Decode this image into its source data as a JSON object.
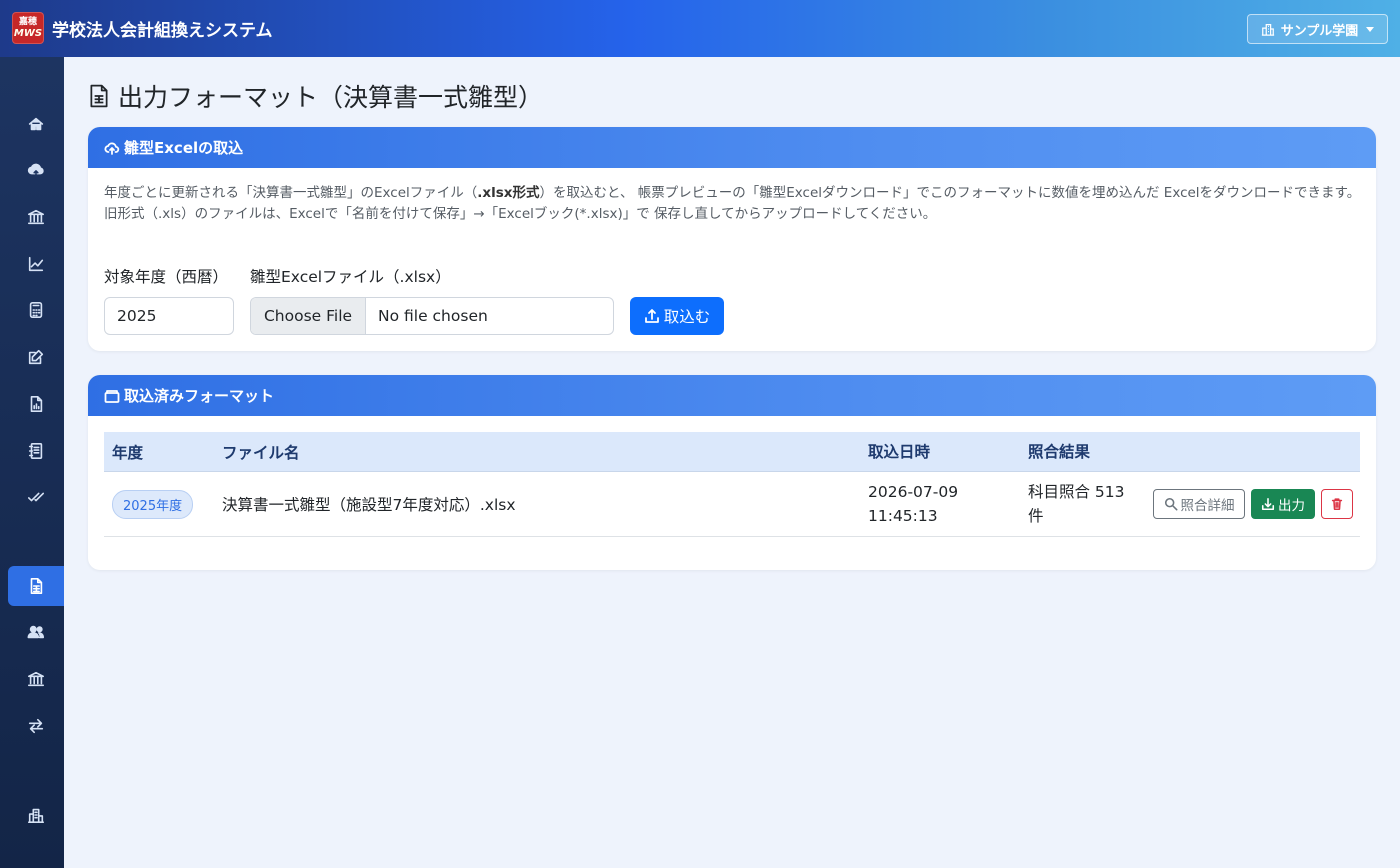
{
  "header": {
    "logo_top": "嘉穂",
    "logo_bottom": "MWS",
    "app_title": "学校法人会計組換えシステム",
    "school_selector": "サンプル学園"
  },
  "sidebar": {
    "items": [
      {
        "icon": "home-icon"
      },
      {
        "icon": "cloud-upload-icon"
      },
      {
        "icon": "bank-icon"
      },
      {
        "icon": "chart-line-icon"
      },
      {
        "icon": "calculator-icon"
      },
      {
        "icon": "edit-icon"
      },
      {
        "icon": "file-chart-icon"
      },
      {
        "icon": "journal-icon"
      },
      {
        "icon": "check-all-icon"
      },
      {
        "icon": "spreadsheet-icon",
        "active": true
      },
      {
        "icon": "users-icon"
      },
      {
        "icon": "institution-icon"
      },
      {
        "icon": "swap-icon"
      },
      {
        "icon": "buildings-icon"
      }
    ]
  },
  "page": {
    "title": "出力フォーマット（決算書一式雛型）"
  },
  "import_card": {
    "header": "雛型Excelの取込",
    "desc_part1": "年度ごとに更新される「決算書一式雛型」のExcelファイル（",
    "desc_bold": ".xlsx形式",
    "desc_part2": "）を取込むと、 帳票プレビューの「雛型Excelダウンロード」でこのフォーマットに数値を埋め込んだ Excelをダウンロードできます。",
    "desc_line2": "旧形式（.xls）のファイルは、Excelで「名前を付けて保存」→「Excelブック(*.xlsx)」で 保存し直してからアップロードしてください。",
    "year_label": "対象年度（西暦）",
    "year_value": "2025",
    "file_label": "雛型Excelファイル（.xlsx）",
    "file_button": "Choose File",
    "file_status": "No file chosen",
    "submit_label": "取込む"
  },
  "imported_card": {
    "header": "取込済みフォーマット",
    "columns": {
      "year": "年度",
      "file": "ファイル名",
      "date": "取込日時",
      "result": "照合結果"
    },
    "rows": [
      {
        "year": "2025年度",
        "file": "決算書一式雛型（施設型7年度対応）.xlsx",
        "date_line1": "2026-07-09",
        "date_line2": "11:45:13",
        "result_line1": "科目照合 513",
        "result_line2": "件",
        "detail_label": "照合詳細",
        "output_label": "出力"
      }
    ]
  }
}
